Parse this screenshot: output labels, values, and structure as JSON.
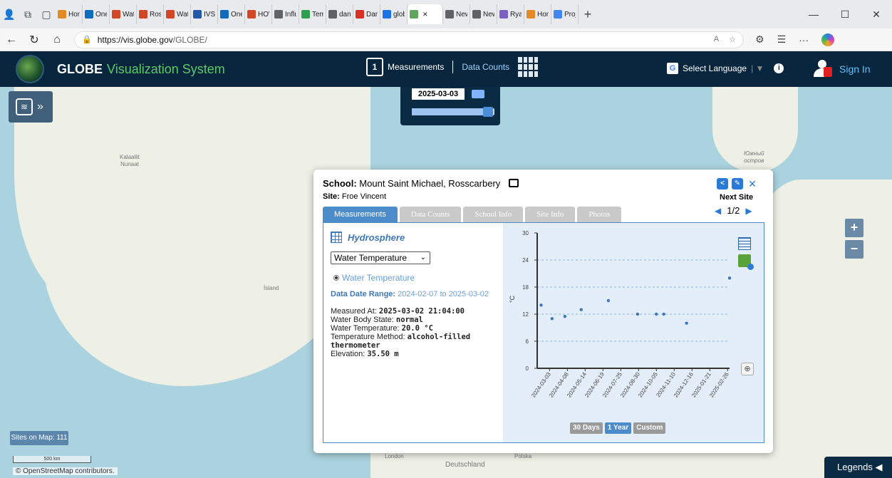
{
  "browser": {
    "tabs": [
      {
        "label": "Hom",
        "color": "#e48a24"
      },
      {
        "label": "One[",
        "color": "#0f6cbd"
      },
      {
        "label": "Wate",
        "color": "#d24726"
      },
      {
        "label": "Ross",
        "color": "#d24726"
      },
      {
        "label": "Wate",
        "color": "#d24726"
      },
      {
        "label": "IVSS",
        "color": "#2457a8"
      },
      {
        "label": "One[",
        "color": "#0f6cbd"
      },
      {
        "label": "HOW",
        "color": "#d24726"
      },
      {
        "label": "Influ",
        "color": "#5f6368"
      },
      {
        "label": "Temp",
        "color": "#2e9e4f"
      },
      {
        "label": "dans",
        "color": "#5f6368"
      },
      {
        "label": "Dans",
        "color": "#d93025"
      },
      {
        "label": "glob",
        "color": "#1a73e8"
      },
      {
        "label": "",
        "color": "#5fa55a",
        "active": true
      },
      {
        "label": "New",
        "color": "#5f6368"
      },
      {
        "label": "New",
        "color": "#5f6368"
      },
      {
        "label": "Ryan",
        "color": "#7b61c4"
      },
      {
        "label": "Hom",
        "color": "#e48a24"
      },
      {
        "label": "Proje",
        "color": "#4285f4"
      }
    ],
    "url_host": "https://vis.globe.gov",
    "url_path": "/GLOBE/"
  },
  "app": {
    "title": "GLOBE",
    "title_accent": "Visualization System",
    "measurements_label": "Measurements",
    "calendar_day": "1",
    "datacounts_label": "Data Counts",
    "language_label": "Select Language",
    "signin_label": "Sign In"
  },
  "timeline": {
    "date": "2025-03-03",
    "progress": 0.92
  },
  "map": {
    "labels": {
      "greenland_1": "Kalaallit",
      "greenland_2": "Nunaat",
      "iceland": "Ísland",
      "ostrov_1": "Южный",
      "ostrov_2": "остров",
      "london": "London",
      "deutschland": "Deutschland",
      "polska": "Polska"
    },
    "sites_on_map": "Sites on Map: 111",
    "scale": "500 km",
    "attribution": "© OpenStreetMap contributors.",
    "legends": "Legends"
  },
  "popup": {
    "school_label": "School:",
    "school": "Mount Saint Michael, Rosscarbery",
    "site_label": "Site:",
    "site": "Froe Vincent",
    "next_site": "Next Site",
    "pager": "1/2",
    "tabs": [
      "Measurements",
      "Data Counts",
      "School Info",
      "Site Info",
      "Photos"
    ],
    "sphere": "Hydrosphere",
    "select_value": "Water Temperature",
    "radio_label": "Water Temperature",
    "date_range_label": "Data Date Range:",
    "date_range": "2024-02-07 to 2025-03-02",
    "details": [
      {
        "label": "Measured At:",
        "value": "2025-03-02 21:04:00"
      },
      {
        "label": "Water Body State:",
        "value": "normal"
      },
      {
        "label": "Water Temperature:",
        "value": "20.0 °C"
      },
      {
        "label": "Temperature Method:",
        "value": "alcohol-filled thermometer"
      },
      {
        "label": "Elevation:",
        "value": "35.50 m"
      }
    ],
    "range_buttons": [
      "30 Days",
      "1 Year",
      "Custom"
    ]
  },
  "chart_data": {
    "type": "scatter",
    "ylabel": "°C",
    "ylim": [
      0,
      30
    ],
    "yticks": [
      0,
      6,
      12,
      18,
      24,
      30
    ],
    "xticks": [
      "2024-03-03",
      "2024-04-08",
      "2024-05-14",
      "2024-06-19",
      "2024-07-25",
      "2024-08-30",
      "2024-10-05",
      "2024-11-10",
      "2024-12-16",
      "2025-01-21",
      "2025-02-26"
    ],
    "xlim": [
      "2024-02-07",
      "2025-03-02"
    ],
    "grid": true,
    "points": [
      {
        "x": "2024-02-15",
        "y": 14.0
      },
      {
        "x": "2024-03-08",
        "y": 11.0
      },
      {
        "x": "2024-04-03",
        "y": 11.5
      },
      {
        "x": "2024-05-06",
        "y": 13.0
      },
      {
        "x": "2024-06-30",
        "y": 15.0
      },
      {
        "x": "2024-08-28",
        "y": 12.0
      },
      {
        "x": "2024-10-05",
        "y": 12.0
      },
      {
        "x": "2024-10-20",
        "y": 12.0
      },
      {
        "x": "2024-12-05",
        "y": 10.0
      },
      {
        "x": "2025-03-02",
        "y": 20.0
      }
    ]
  }
}
